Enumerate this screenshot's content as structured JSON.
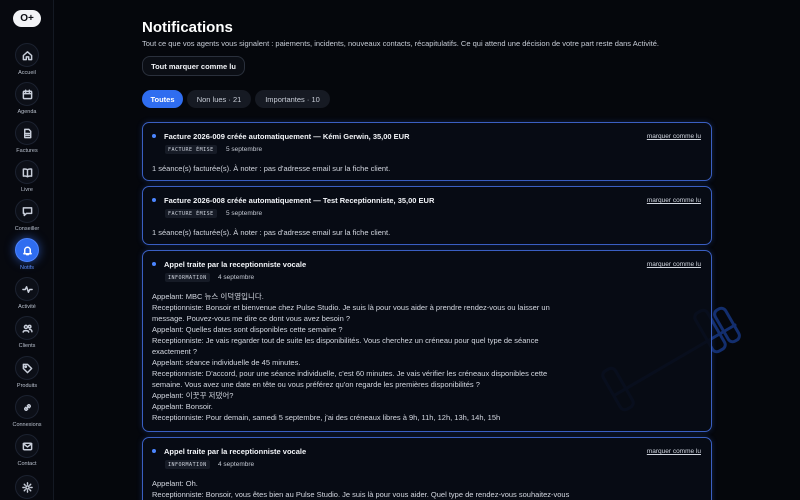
{
  "app": {
    "logo_text": "O+"
  },
  "sidebar": {
    "items": [
      {
        "label": "Accueil",
        "icon": "home-icon"
      },
      {
        "label": "Agenda",
        "icon": "calendar-icon"
      },
      {
        "label": "Factures",
        "icon": "document-icon"
      },
      {
        "label": "Livre",
        "icon": "book-icon"
      },
      {
        "label": "Conseiller",
        "icon": "chat-icon"
      },
      {
        "label": "Notifs",
        "icon": "bell-icon",
        "active": true
      },
      {
        "label": "Activité",
        "icon": "pulse-icon"
      },
      {
        "label": "Clients",
        "icon": "users-icon"
      },
      {
        "label": "Produits",
        "icon": "tag-icon"
      },
      {
        "label": "Connexions",
        "icon": "link-icon"
      },
      {
        "label": "Contact",
        "icon": "mail-icon"
      },
      {
        "label": "",
        "icon": "gear-icon"
      }
    ]
  },
  "header": {
    "title": "Notifications",
    "subtitle": "Tout ce que vos agents vous signalent : paiements, incidents, nouveaux contacts, récapitulatifs. Ce qui attend une décision de votre part reste dans Activité.",
    "mark_all_label": "Tout marquer comme lu"
  },
  "filters": [
    {
      "label": "Toutes",
      "active": true
    },
    {
      "label": "Non lues · 21",
      "active": false
    },
    {
      "label": "Importantes · 10",
      "active": false
    }
  ],
  "notifications": [
    {
      "title": "Facture 2026-009 créée automatiquement — Kémi Gerwin, 35,00 EUR",
      "badge": "FACTURE ÉMISE",
      "date": "5 septembre",
      "mark_label": "marquer comme lu",
      "body": [
        "1 séance(s) facturée(s). À noter : pas d'adresse email sur la fiche client."
      ]
    },
    {
      "title": "Facture 2026-008 créée automatiquement — Test Receptionniste, 35,00 EUR",
      "badge": "FACTURE ÉMISE",
      "date": "5 septembre",
      "mark_label": "marquer comme lu",
      "body": [
        "1 séance(s) facturée(s). À noter : pas d'adresse email sur la fiche client."
      ]
    },
    {
      "title": "Appel traite par la receptionniste vocale",
      "badge": "INFORMATION",
      "date": "4 septembre",
      "mark_label": "marquer comme lu",
      "body": [
        "Appelant: MBC 뉴스 이덕영입니다.",
        "Receptionniste: Bonsoir et bienvenue chez Pulse Studio. Je suis là pour vous aider à prendre rendez-vous ou laisser un",
        "message. Pouvez-vous me dire ce dont vous avez besoin ?",
        "Appelant: Quelles dates sont disponibles cette semaine ?",
        "Receptionniste: Je vais regarder tout de suite les disponibilités. Vous cherchez un créneau pour quel type de séance",
        "exactement ?",
        "Appelant: séance individuelle de 45 minutes.",
        "Receptionniste: D'accord, pour une séance individuelle, c'est 60 minutes. Je vais vérifier les créneaux disponibles cette",
        "semaine. Vous avez une date en tête ou vous préférez qu'on regarde les premières disponibilités ?",
        "Appelant: 이꿋꾸 저댔어?",
        "Appelant: Bonsoir.",
        "Receptionniste: Pour demain, samedi 5 septembre, j'ai des créneaux libres à 9h, 11h, 12h, 13h, 14h, 15h"
      ]
    },
    {
      "title": "Appel traite par la receptionniste vocale",
      "badge": "INFORMATION",
      "date": "4 septembre",
      "mark_label": "marquer comme lu",
      "body": [
        "Appelant: Oh.",
        "Receptionniste: Bonsoir, vous êtes bien au Pulse Studio. Je suis là pour vous aider. Quel type de rendez-vous souhaitez-vous"
      ]
    }
  ],
  "colors": {
    "accent": "#2f6df0",
    "card_border": "#3a5fc2",
    "background": "#05070c"
  }
}
